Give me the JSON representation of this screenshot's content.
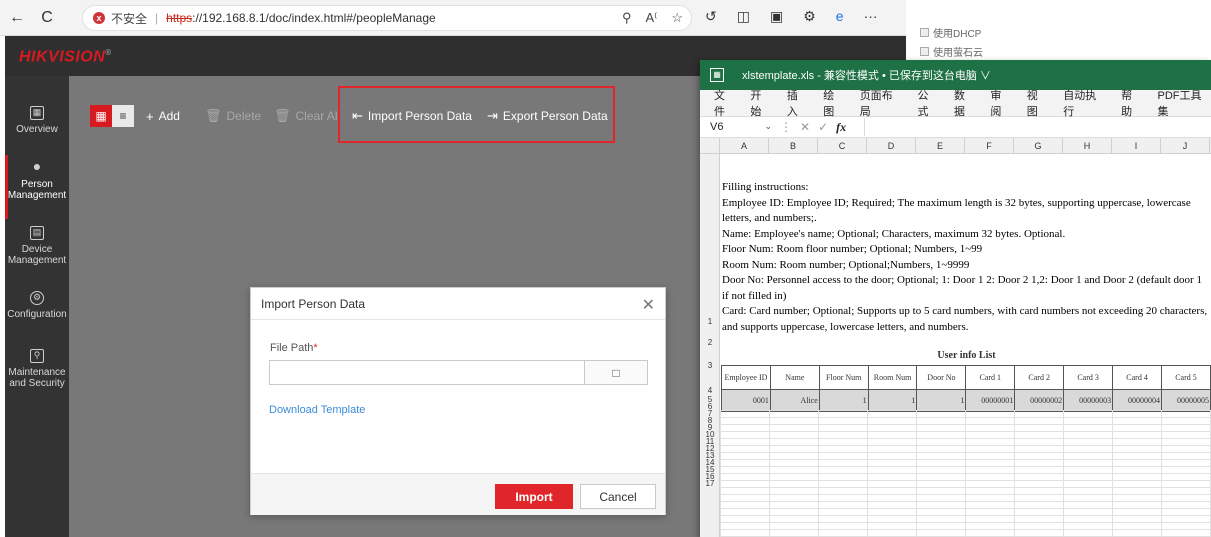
{
  "browser": {
    "back_icon": "←",
    "refresh_icon": "C",
    "warning_icon": "x",
    "insecure_label": "不安全",
    "url_scheme": "https",
    "url_rest": "://192.168.8.1/doc/index.html#/peopleManage",
    "more_icon": "···"
  },
  "background_page": {
    "opt1": "使用DHCP",
    "opt2": "使用萤石云"
  },
  "app": {
    "logo": "HIKVISION",
    "sidebar": [
      {
        "label": "Overview",
        "icon": "overview-icon"
      },
      {
        "label": "Person Management",
        "icon": "person-icon"
      },
      {
        "label": "Device Management",
        "icon": "device-icon"
      },
      {
        "label": "Configuration",
        "icon": "gear-icon"
      },
      {
        "label": "Maintenance and Security",
        "icon": "maintenance-icon"
      }
    ],
    "toolbar": {
      "add": "Add",
      "delete": "Delete",
      "clear_all": "Clear All",
      "import": "Import Person Data",
      "export": "Export Person Data"
    }
  },
  "dialog": {
    "title": "Import Person Data",
    "file_path_label": "File Path",
    "required_mark": "*",
    "file_path_value": "",
    "download_template": "Download Template",
    "import_btn": "Import",
    "cancel_btn": "Cancel"
  },
  "excel": {
    "title": "xlstemplate.xls - 兼容性模式 • 已保存到这台电脑 ∨",
    "menu": [
      "文件",
      "开始",
      "插入",
      "绘图",
      "页面布局",
      "公式",
      "数据",
      "审阅",
      "视图",
      "自动执行",
      "帮助",
      "PDF工具集"
    ],
    "cell_ref": "V6",
    "columns": [
      "A",
      "B",
      "C",
      "D",
      "E",
      "F",
      "G",
      "H",
      "I",
      "J"
    ],
    "instructions": [
      "Filling instructions:",
      "Employee ID: Employee ID; Required; The maximum length is 32 bytes, supporting uppercase, lowercase letters, and numbers;.",
      "Name: Employee's name; Optional; Characters, maximum 32 bytes. Optional.",
      "Floor Num: Room floor number; Optional; Numbers, 1~99",
      "Room Num: Room number; Optional;Numbers, 1~9999",
      "Door No: Personnel access to the door; Optional; 1: Door 1 2: Door 2 1,2: Door 1 and Door 2 (default door 1 if not filled in)",
      "Card: Card number; Optional; Supports up to 5 card numbers, with card numbers not exceeding 20 characters, and supports uppercase, lowercase letters, and numbers."
    ],
    "list_title": "User info List",
    "headers": [
      "Employee ID",
      "Name",
      "Floor Num",
      "Room Num",
      "Door No",
      "Card 1",
      "Card 2",
      "Card 3",
      "Card 4",
      "Card 5"
    ],
    "row": [
      "0001",
      "Alice",
      "1",
      "1",
      "1",
      "00000001",
      "00000002",
      "00000003",
      "00000004",
      "00000005"
    ],
    "row_numbers": [
      "1",
      "2",
      "3",
      "4",
      "5",
      "6",
      "7",
      "8",
      "9",
      "10",
      "11",
      "12",
      "13",
      "14",
      "15",
      "16",
      "17"
    ]
  },
  "colors": {
    "accent": "#d71920",
    "excel_green": "#1e7145",
    "link": "#3d8cd8"
  }
}
